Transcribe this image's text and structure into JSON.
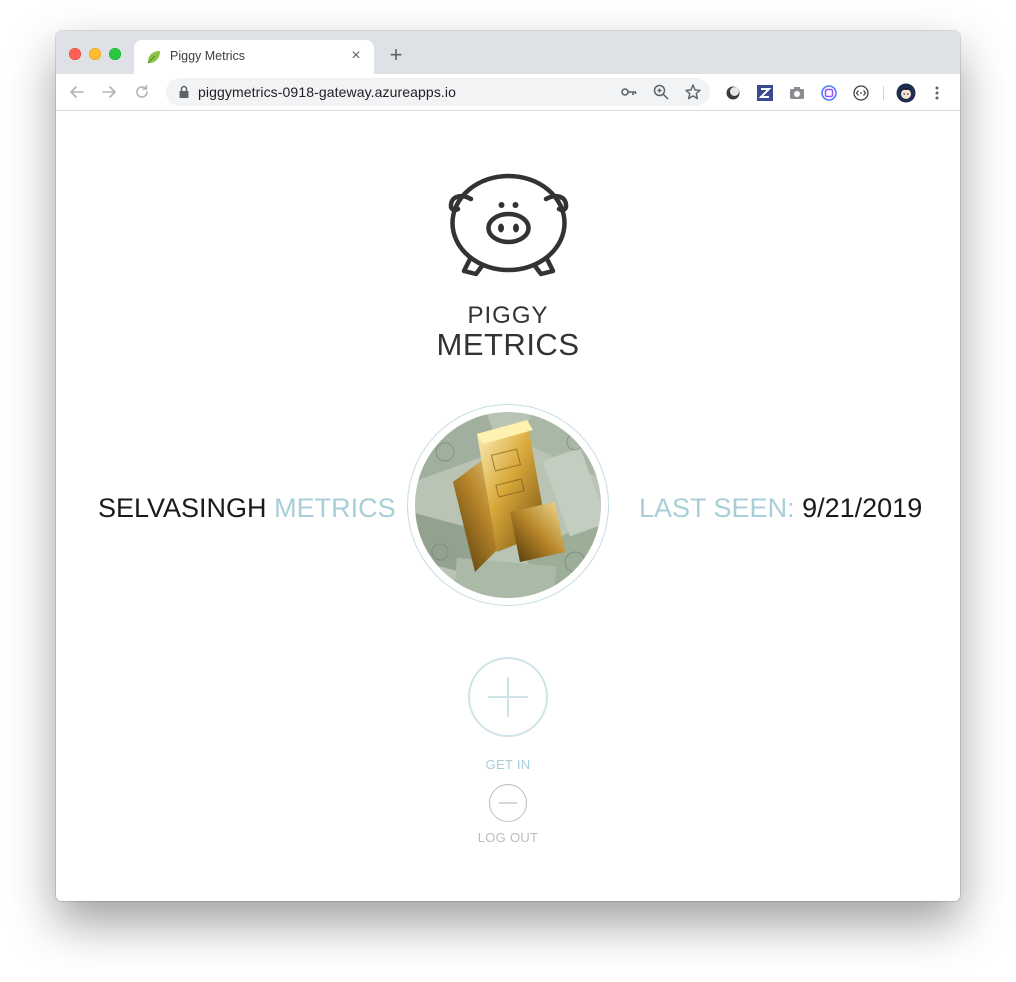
{
  "browser": {
    "tab_title": "Piggy Metrics",
    "tab_favicon": "leaf-icon",
    "url": "piggymetrics-0918-gateway.azureapps.io",
    "new_tab_label": "+",
    "close_tab_label": "×",
    "toolbar_icons": [
      "back-icon",
      "forward-icon",
      "reload-icon",
      "lock-icon",
      "key-icon",
      "zoom-icon",
      "star-icon"
    ],
    "extensions": [
      "dark-reader-extension-icon",
      "z-extension-icon",
      "camera-extension-icon",
      "ring-extension-icon",
      "code-extension-icon",
      "profile-avatar-icon",
      "more-menu-icon"
    ]
  },
  "brand": {
    "logo": "pig-icon",
    "line1": "PIGGY",
    "line2": "METRICS"
  },
  "user": {
    "name": "SELVASINGH",
    "suffix": "METRICS",
    "last_seen_label": "LAST SEEN:",
    "last_seen_date": "9/21/2019",
    "avatar": "gold-bars-and-dollar-bills-image"
  },
  "actions": {
    "get_in_label": "GET IN",
    "log_out_label": "LOG OUT"
  },
  "colors": {
    "accent": "#a8cfd8",
    "text": "#1a1a1a",
    "logo": "#333333"
  }
}
